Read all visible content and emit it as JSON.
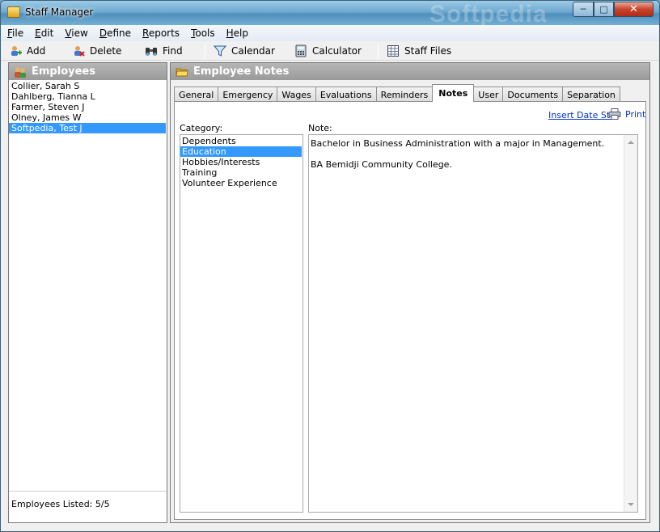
{
  "window": {
    "title": "Staff Manager",
    "watermark": "Softpedia"
  },
  "menu": [
    {
      "key": "F",
      "rest": "ile"
    },
    {
      "key": "E",
      "rest": "dit"
    },
    {
      "key": "V",
      "rest": "iew"
    },
    {
      "key": "D",
      "rest": "efine"
    },
    {
      "key": "R",
      "rest": "eports"
    },
    {
      "key": "T",
      "rest": "ools"
    },
    {
      "key": "H",
      "rest": "elp"
    }
  ],
  "toolbar": {
    "add": "Add",
    "delete": "Delete",
    "find": "Find",
    "calendar": "Calendar",
    "calculator": "Calculator",
    "staff_files": "Staff Files"
  },
  "employees": {
    "header": "Employees",
    "items": [
      "Collier, Sarah S",
      "Dahlberg, Tianna L",
      "Farmer, Steven J",
      "Olney, James W",
      "Softpedia, Test J"
    ],
    "selected_index": 4,
    "footer": "Employees Listed: 5/5"
  },
  "notes": {
    "header": "Employee Notes",
    "tabs": [
      "General",
      "Emergency",
      "Wages",
      "Evaluations",
      "Reminders",
      "Notes",
      "User",
      "Documents",
      "Separation"
    ],
    "active_tab": 5,
    "insert_link": "Insert Date Sta",
    "print": "Print",
    "category_label": "Category:",
    "note_label": "Note:",
    "categories": [
      "Dependents",
      "Education",
      "Hobbies/Interests",
      "Training",
      "Volunteer Experience"
    ],
    "selected_category": 1,
    "note_text": "Bachelor in Business Administration with a major in Management.\n\nBA Bemidji Community College."
  },
  "colors": {
    "selection": "#3399ff",
    "link": "#0033cc",
    "panel_header": "#9a9a9a"
  }
}
